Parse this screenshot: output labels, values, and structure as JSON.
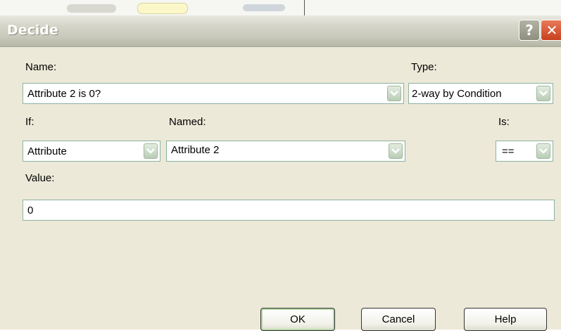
{
  "dialog": {
    "title": "Decide",
    "help_glyph": "?",
    "close_glyph": "✕"
  },
  "form": {
    "name_label": "Name:",
    "name_value": "Attribute 2 is 0?",
    "type_label": "Type:",
    "type_value": "2-way by Condition",
    "if_label": "If:",
    "if_value": "Attribute",
    "named_label": "Named:",
    "named_value": "Attribute 2",
    "is_label": "Is:",
    "is_value": "==",
    "value_label": "Value:",
    "value_value": "0"
  },
  "buttons": {
    "ok": "OK",
    "cancel": "Cancel",
    "help": "Help"
  },
  "icons": {
    "dropdown": "chevron-down-icon",
    "help": "question-icon",
    "close": "close-icon"
  },
  "colors": {
    "dialog_bg": "#ece9d8",
    "field_border": "#8db2a0",
    "close_red": "#c8401f"
  }
}
